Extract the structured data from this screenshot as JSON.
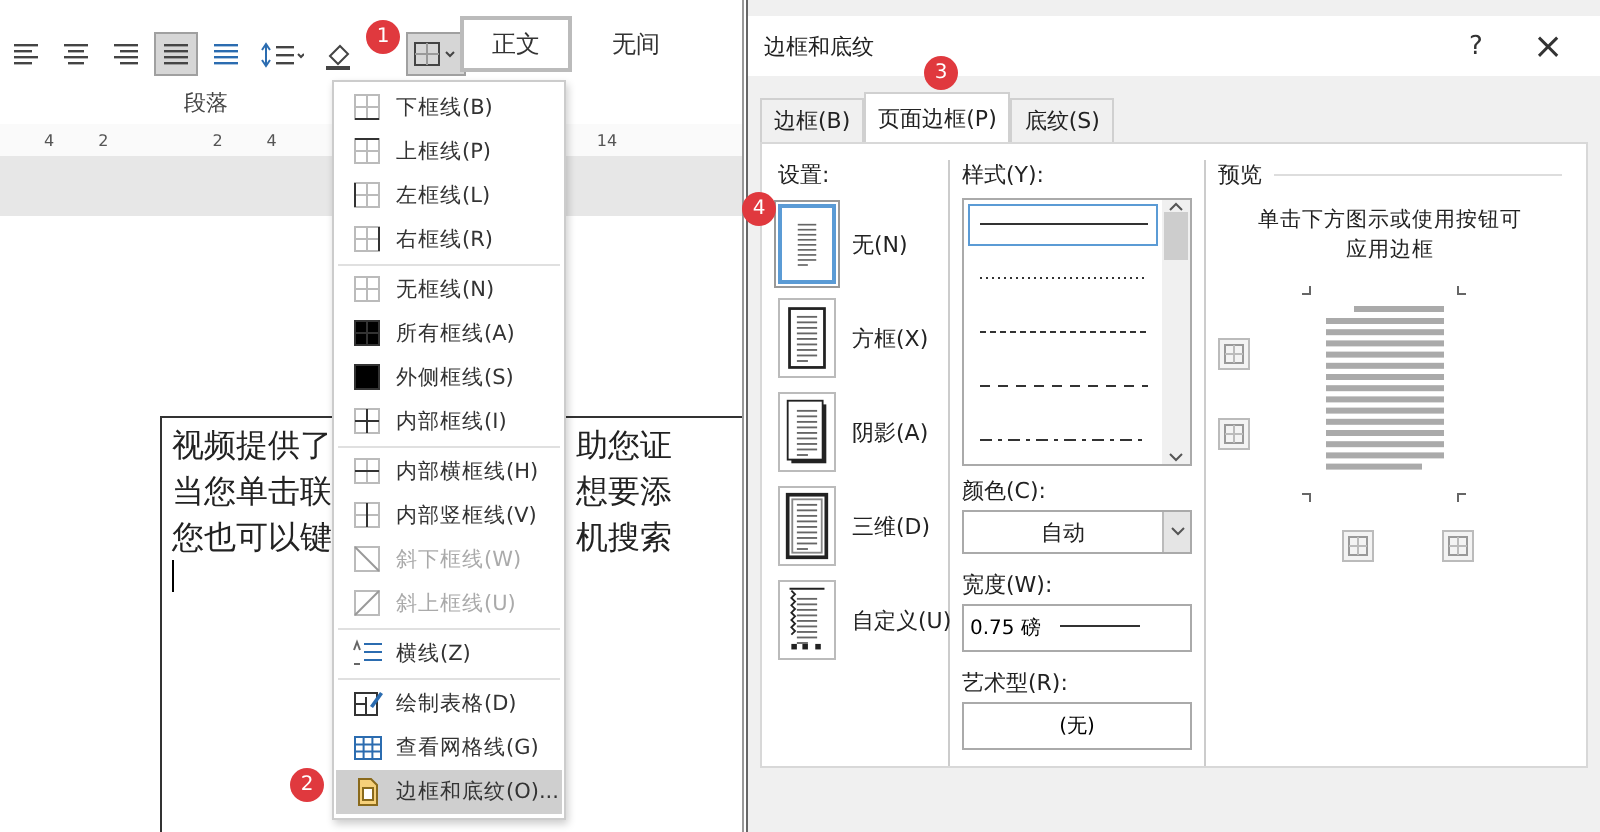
{
  "ribbon": {
    "tools": [
      {
        "kind": "align-left",
        "selected": false
      },
      {
        "kind": "align-center",
        "selected": false
      },
      {
        "kind": "align-right",
        "selected": false
      },
      {
        "kind": "justify",
        "selected": true
      },
      {
        "kind": "distribute",
        "selected": false
      },
      {
        "kind": "line-spacing",
        "selected": false
      },
      {
        "kind": "shading",
        "selected": false
      },
      {
        "kind": "borders",
        "selected": true
      }
    ],
    "group_label": "段落",
    "styles": [
      {
        "label": "正文",
        "selected": true
      },
      {
        "label": "无间",
        "selected": false
      }
    ]
  },
  "ruler": {
    "marks": [
      "4",
      "2",
      "2",
      "4"
    ],
    "far_mark": "14"
  },
  "document": {
    "lines_left": [
      "视频提供了",
      "当您单击联",
      "您也可以键"
    ],
    "lines_right": [
      "助您证",
      "想要添",
      "机搜索"
    ]
  },
  "border_menu": {
    "groups": [
      [
        {
          "kind": "bottom",
          "label": "下框线(B)",
          "disabled": false,
          "selected": false
        },
        {
          "kind": "top",
          "label": "上框线(P)",
          "disabled": false,
          "selected": false
        },
        {
          "kind": "left",
          "label": "左框线(L)",
          "disabled": false,
          "selected": false
        },
        {
          "kind": "right",
          "label": "右框线(R)",
          "disabled": false,
          "selected": false
        }
      ],
      [
        {
          "kind": "none",
          "label": "无框线(N)",
          "disabled": false,
          "selected": false
        },
        {
          "kind": "all",
          "label": "所有框线(A)",
          "disabled": false,
          "selected": false
        },
        {
          "kind": "outside",
          "label": "外侧框线(S)",
          "disabled": false,
          "selected": false
        },
        {
          "kind": "inside",
          "label": "内部框线(I)",
          "disabled": false,
          "selected": false
        }
      ],
      [
        {
          "kind": "inside-h",
          "label": "内部横框线(H)",
          "disabled": false,
          "selected": false
        },
        {
          "kind": "inside-v",
          "label": "内部竖框线(V)",
          "disabled": false,
          "selected": false
        },
        {
          "kind": "diag-down",
          "label": "斜下框线(W)",
          "disabled": true,
          "selected": false
        },
        {
          "kind": "diag-up",
          "label": "斜上框线(U)",
          "disabled": true,
          "selected": false
        }
      ],
      [
        {
          "kind": "hline",
          "label": "横线(Z)",
          "disabled": false,
          "selected": false
        }
      ],
      [
        {
          "kind": "draw-table",
          "label": "绘制表格(D)",
          "disabled": false,
          "selected": false
        },
        {
          "kind": "gridlines",
          "label": "查看网格线(G)",
          "disabled": false,
          "selected": false
        },
        {
          "kind": "borders-shading",
          "label": "边框和底纹(O)...",
          "disabled": false,
          "selected": true
        }
      ]
    ]
  },
  "steps": [
    "1",
    "2",
    "3",
    "4"
  ],
  "dialog": {
    "title": "边框和底纹",
    "help": "?",
    "close": "×",
    "tabs": [
      {
        "label": "边框(B)",
        "selected": false
      },
      {
        "label": "页面边框(P)",
        "selected": true
      },
      {
        "label": "底纹(S)",
        "selected": false
      }
    ],
    "setting": {
      "label": "设置:",
      "items": [
        {
          "kind": "none",
          "label": "无(N)",
          "selected": true
        },
        {
          "kind": "box",
          "label": "方框(X)",
          "selected": false
        },
        {
          "kind": "shadow",
          "label": "阴影(A)",
          "selected": false
        },
        {
          "kind": "threed",
          "label": "三维(D)",
          "selected": false
        },
        {
          "kind": "custom",
          "label": "自定义(U)",
          "selected": false
        }
      ]
    },
    "style": {
      "label": "样式(Y):",
      "lines": [
        {
          "kind": "solid",
          "selected": true
        },
        {
          "kind": "dotted",
          "selected": false
        },
        {
          "kind": "dashed",
          "selected": false
        },
        {
          "kind": "dash-long",
          "selected": false
        },
        {
          "kind": "dash-dot",
          "selected": false
        }
      ]
    },
    "color": {
      "label": "颜色(C):",
      "value": "自动"
    },
    "width": {
      "label": "宽度(W):",
      "value": "0.75 磅"
    },
    "art": {
      "label": "艺术型(R):",
      "value": "(无)"
    },
    "preview": {
      "label": "预览",
      "hint": "单击下方图示或使用按钮可应用边框"
    }
  }
}
